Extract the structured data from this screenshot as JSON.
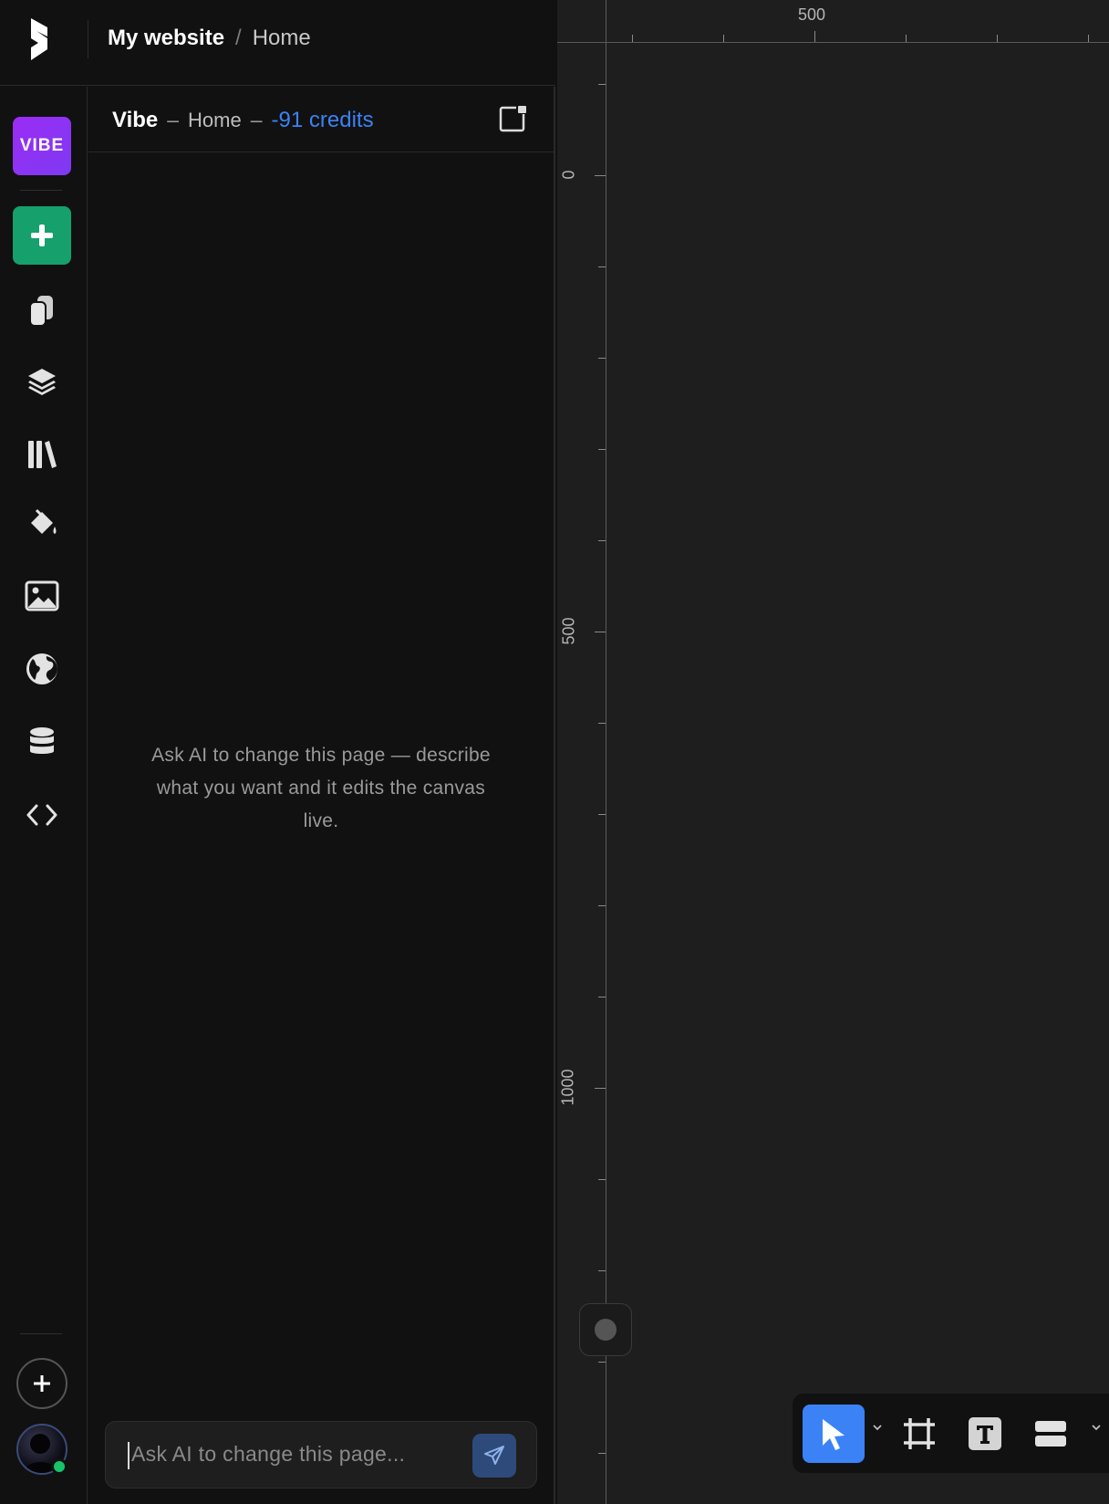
{
  "header": {
    "site_name": "My website",
    "separator": "/",
    "page_name": "Home"
  },
  "rail": {
    "vibe_label": "VIBE",
    "icons": [
      "vibe-icon",
      "add-icon",
      "pages-icon",
      "layers-icon",
      "library-icon",
      "paint-bucket-icon",
      "image-icon",
      "globe-icon",
      "database-icon",
      "code-icon"
    ]
  },
  "panel": {
    "title": "Vibe",
    "dash1": "–",
    "page": "Home",
    "dash2": "–",
    "credits": "-91 credits",
    "empty_message": "Ask AI to change this page — describe what you want and it edits the canvas live.",
    "input_placeholder": "Ask AI to change this page..."
  },
  "canvas": {
    "ruler_top_labels": [
      "500"
    ],
    "ruler_left_labels": [
      "0",
      "500",
      "1000"
    ]
  },
  "toolbar": {
    "tools": [
      "select-tool",
      "frame-tool",
      "text-tool",
      "stack-tool"
    ],
    "active": "select-tool"
  },
  "colors": {
    "accent": "#3b82f6",
    "vibe": "#8b30f4",
    "add": "#16a06c",
    "online": "#17c36b"
  }
}
